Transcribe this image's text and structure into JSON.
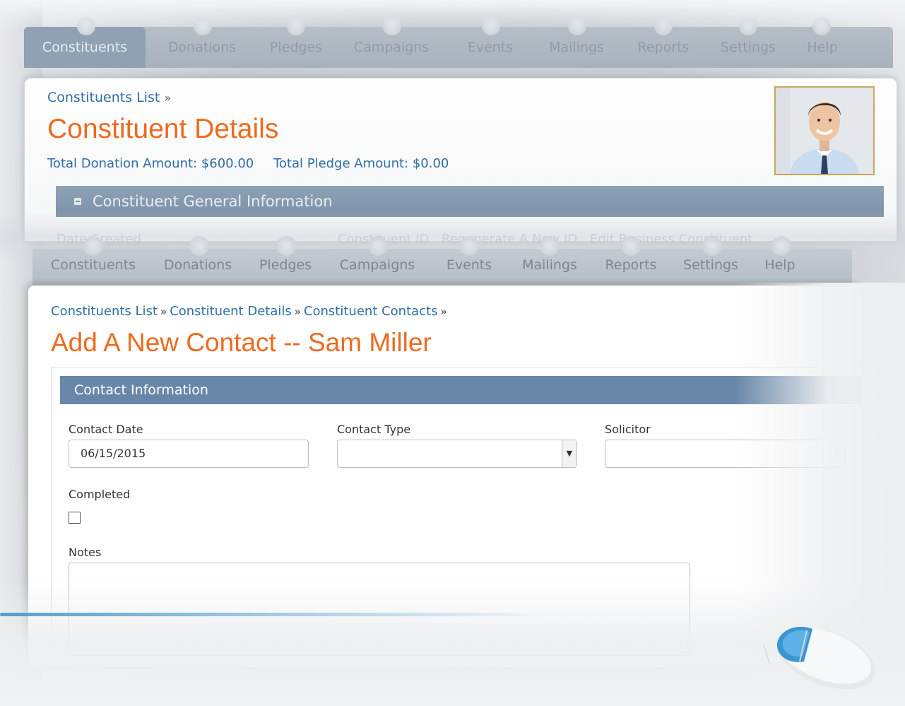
{
  "back_window": {
    "nav": {
      "tabs": [
        {
          "label": "Constituents",
          "active": true
        },
        {
          "label": "Donations"
        },
        {
          "label": "Pledges"
        },
        {
          "label": "Campaigns"
        },
        {
          "label": "Events"
        },
        {
          "label": "Mailings"
        },
        {
          "label": "Reports"
        },
        {
          "label": "Settings"
        },
        {
          "label": "Help"
        }
      ]
    },
    "breadcrumb": {
      "link": "Constituents List",
      "sep": "»"
    },
    "title": "Constituent Details",
    "totals": {
      "donation": "Total Donation Amount: $600.00",
      "pledge": "Total Pledge Amount: $0.00"
    },
    "section_title": "Constituent General Information",
    "faded_fields": {
      "date_created": "Date Created",
      "constituent_id": "Constituent ID",
      "regenerate": "Regenerate A New ID",
      "edit_business": "Edit Business Constituent"
    }
  },
  "front_window": {
    "nav": {
      "tabs": [
        {
          "label": "Constituents"
        },
        {
          "label": "Donations"
        },
        {
          "label": "Pledges"
        },
        {
          "label": "Campaigns"
        },
        {
          "label": "Events"
        },
        {
          "label": "Mailings"
        },
        {
          "label": "Reports"
        },
        {
          "label": "Settings"
        },
        {
          "label": "Help"
        }
      ]
    },
    "breadcrumb": {
      "items": [
        "Constituents List",
        "Constituent Details",
        "Constituent Contacts"
      ],
      "sep": "»"
    },
    "title": "Add A New Contact -- Sam Miller",
    "section_title": "Contact Information",
    "form": {
      "contact_date": {
        "label": "Contact Date",
        "value": "06/15/2015"
      },
      "contact_type": {
        "label": "Contact Type",
        "value": ""
      },
      "solicitor": {
        "label": "Solicitor",
        "value": ""
      },
      "completed": {
        "label": "Completed",
        "checked": false
      },
      "notes": {
        "label": "Notes",
        "value": ""
      }
    }
  },
  "colors": {
    "accent_orange": "#ee6a1f",
    "link_blue": "#2e6da4",
    "section_header": "#6887a8",
    "photo_border": "#c4a85a"
  }
}
